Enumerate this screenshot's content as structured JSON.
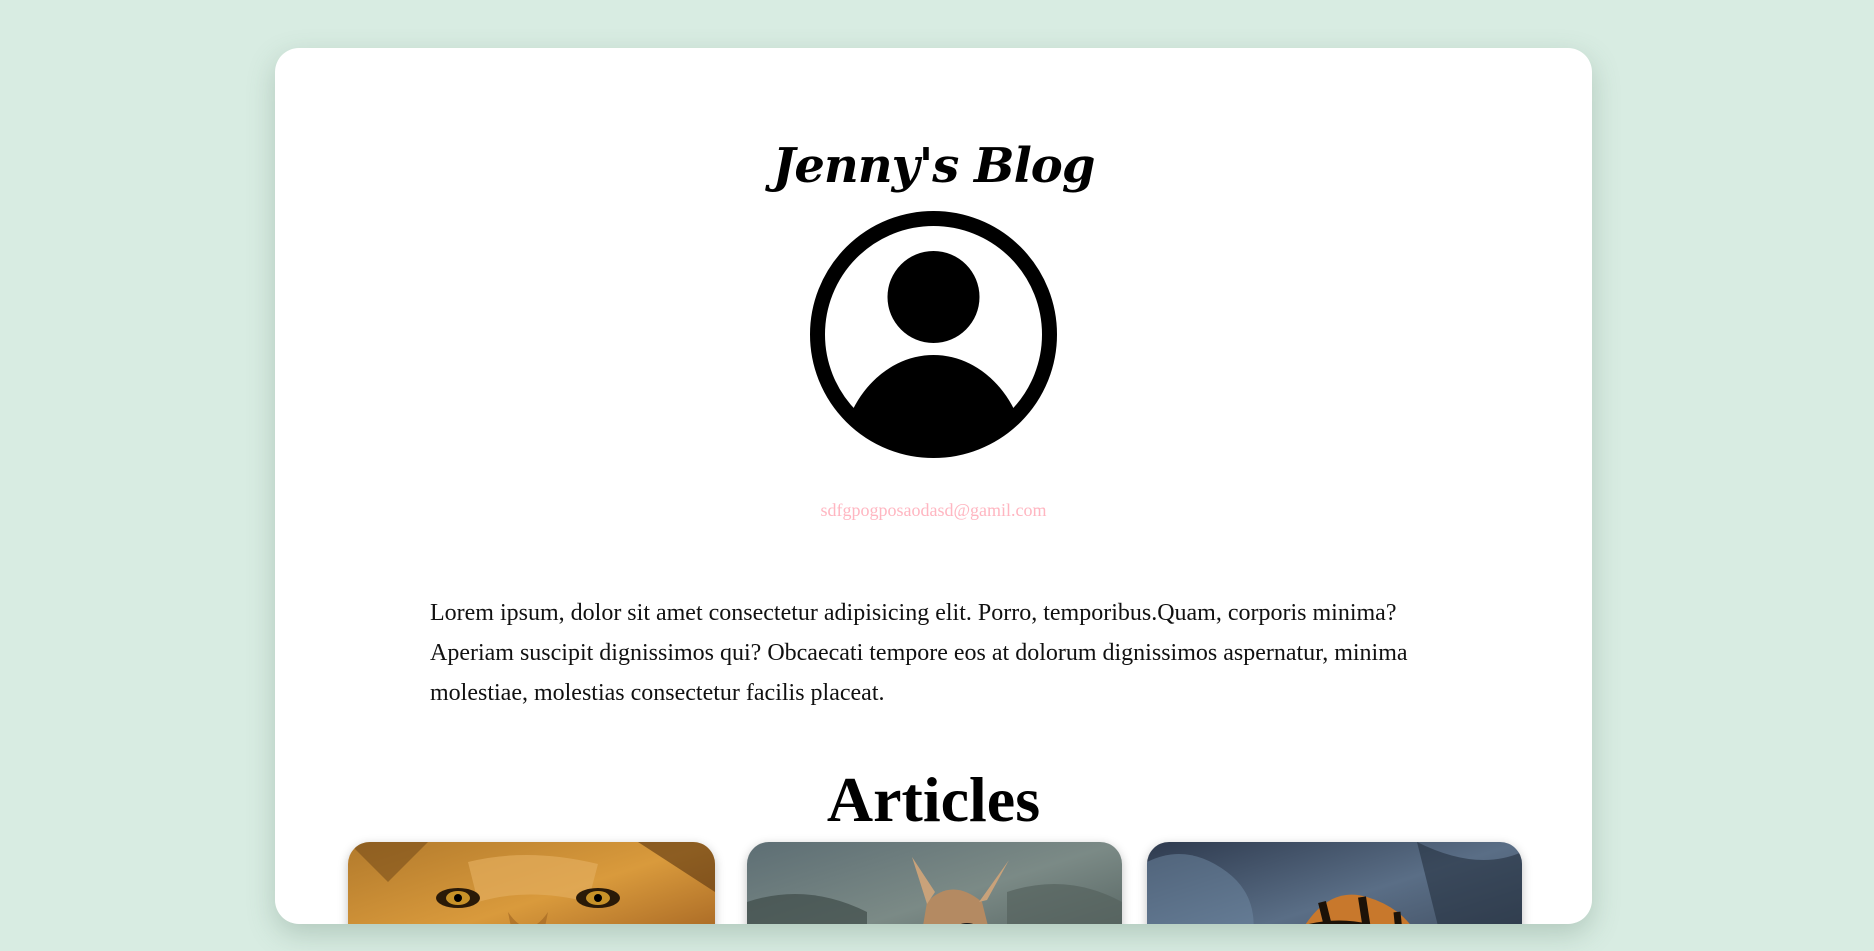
{
  "blog": {
    "title": "Jenny's Blog",
    "avatar_icon": "user-avatar-icon",
    "email": "sdfgpogposaodasd@gamil.com",
    "bio": "Lorem ipsum, dolor sit amet consectetur adipisicing elit. Porro, temporibus.Quam, corporis minima? Aperiam suscipit dignissimos qui? Obcaecati tempore eos at dolorum dignissimos aspernatur, minima molestiae, molestias consectetur facilis placeat."
  },
  "articles": {
    "heading": "Articles",
    "cards": [
      {
        "image": "lion-image"
      },
      {
        "image": "antelope-image"
      },
      {
        "image": "tiger-image"
      }
    ]
  },
  "colors": {
    "page_background": "#d8ece2",
    "card_background": "#ffffff",
    "email_text": "#ffb6c1"
  }
}
